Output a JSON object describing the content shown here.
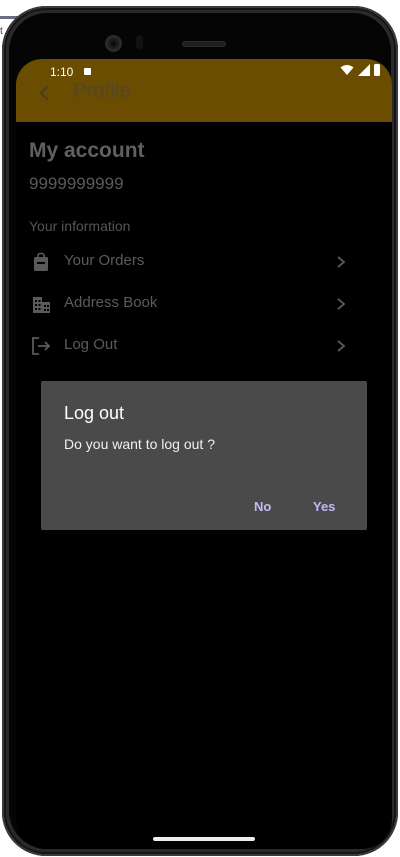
{
  "status_bar": {
    "time": "1:10"
  },
  "appbar": {
    "title": "Profile",
    "color": "#6a4d00"
  },
  "account": {
    "title": "My account",
    "phone": "9999999999",
    "section_label": "Your information"
  },
  "menu": {
    "items": [
      {
        "label": "Your Orders",
        "icon": "orders-bag-icon"
      },
      {
        "label": "Address Book",
        "icon": "building-icon"
      },
      {
        "label": "Log Out",
        "icon": "logout-icon"
      }
    ]
  },
  "dialog": {
    "title": "Log out",
    "message": "Do you want to log out ?",
    "no_label": "No",
    "yes_label": "Yes",
    "button_color": "#c5b7f4",
    "background": "#4a4a4a"
  }
}
